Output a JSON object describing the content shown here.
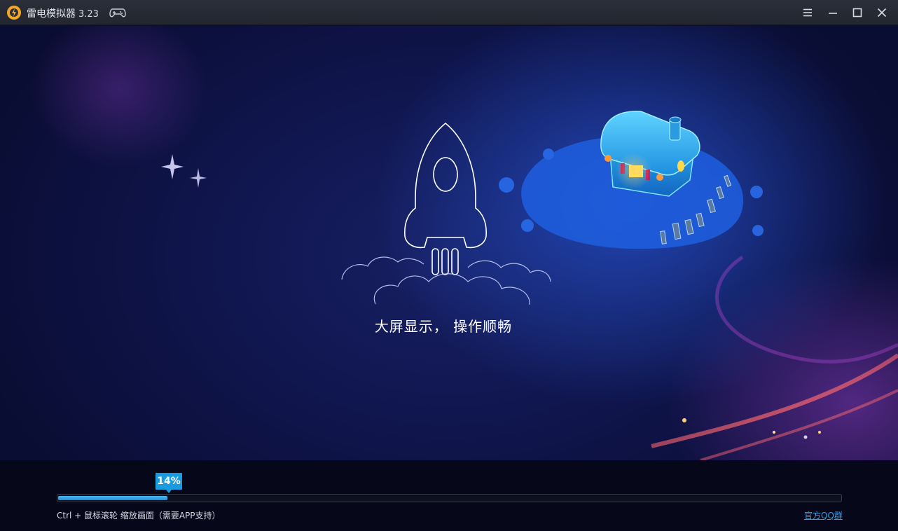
{
  "window": {
    "title": "雷电模拟器",
    "version": "3.23"
  },
  "icons": {
    "logo": "ldplayer-logo-icon",
    "gamepad": "gamepad-icon",
    "menu": "menu-icon",
    "minimize": "minimize-icon",
    "maximize": "maximize-icon",
    "close": "close-icon",
    "rocket": "rocket-illustration",
    "house": "floating-house-illustration"
  },
  "colors": {
    "accent": "#1a9be0",
    "link": "#2d9fe8",
    "logo": "#f5a623"
  },
  "splash": {
    "slogan": "大屏显示， 操作顺畅"
  },
  "progress": {
    "label": "14%",
    "value": 14
  },
  "footer": {
    "hint": "Ctrl + 鼠标滚轮 缩放画面（需要APP支持）",
    "qq_link": "官方QQ群"
  }
}
